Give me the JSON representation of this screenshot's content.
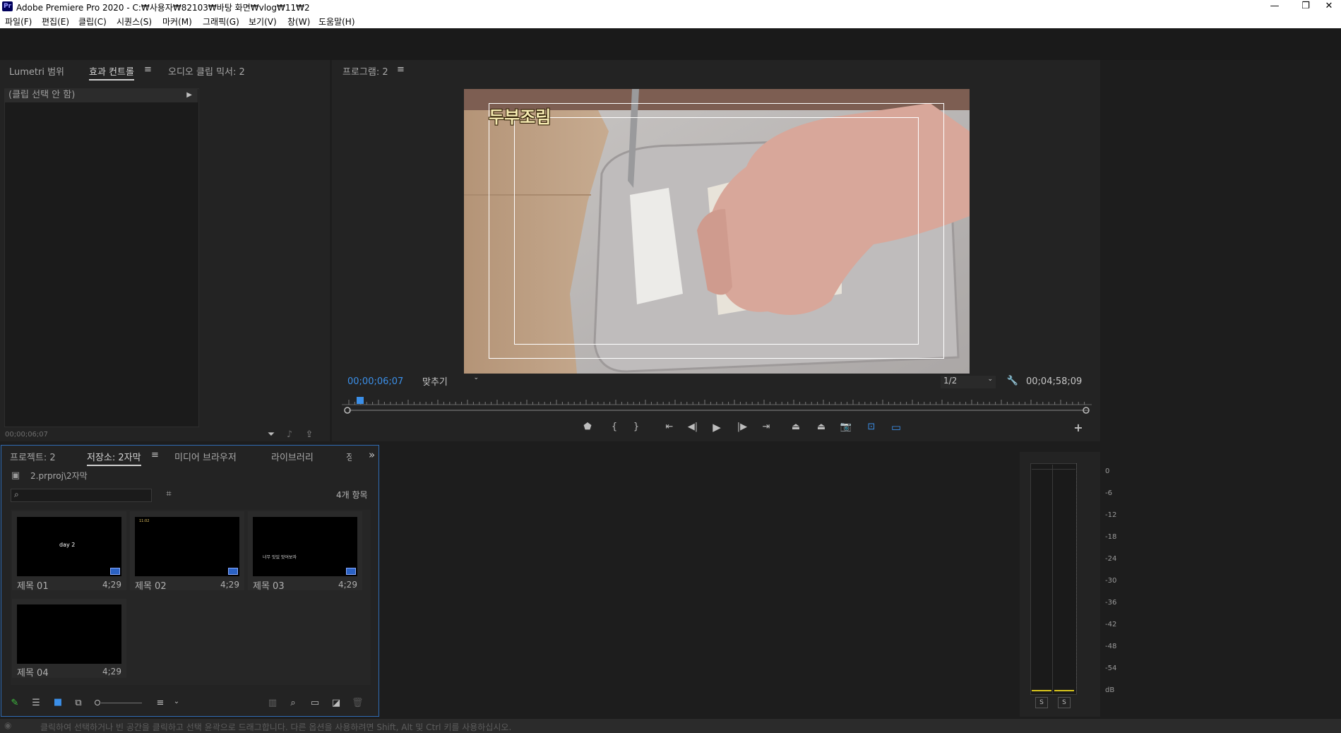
{
  "window": {
    "app_icon": "Pr",
    "title": "Adobe Premiere Pro 2020 - C:₩사용자₩82103₩바탕 화면₩vlog₩11₩2",
    "minimize": "—",
    "restore": "❐",
    "close": "✕"
  },
  "menu": [
    "파일(F)",
    "편집(E)",
    "클립(C)",
    "시퀀스(S)",
    "마커(M)",
    "그래픽(G)",
    "보기(V)",
    "창(W)",
    "도움말(H)"
  ],
  "effects_panel": {
    "tabs": [
      "Lumetri 범위",
      "효과 컨트롤",
      "오디오 클립 믹서: 2"
    ],
    "active_tab": "효과 컨트롤",
    "menu_icon": "≡",
    "clip_status": "(클립 선택 안 함)",
    "timecode": "00;00;06;07"
  },
  "program_monitor": {
    "tab": "프로그램: 2",
    "menu_icon": "≡",
    "title_overlay": "두부조림",
    "current_timecode": "00;00;06;07",
    "fit_select": "맞추기",
    "resolution_select": "1/2",
    "duration_timecode": "00;04;58;09",
    "add_button": "+"
  },
  "project_panel": {
    "tabs": [
      "프로젝트: 2",
      "저장소: 2자막",
      "미디어 브라우저",
      "라이브러리",
      "정"
    ],
    "active_tab": "저장소: 2자막",
    "menu_icon": "≡",
    "overflow_icon": "»",
    "path": "2.prproj\\2자막",
    "search_placeholder": "",
    "item_count": "4개 항목",
    "items": [
      {
        "name": "제목 01",
        "duration": "4;29",
        "thumb_text": "day 2"
      },
      {
        "name": "제목 02",
        "duration": "4;29",
        "thumb_text": "11:02"
      },
      {
        "name": "제목 03",
        "duration": "4;29",
        "thumb_text": "너무 맛있 맛어보자"
      },
      {
        "name": "제목 04",
        "duration": "4;29",
        "thumb_text": ""
      }
    ]
  },
  "audio_meter": {
    "scale": [
      "0",
      "-6",
      "-12",
      "-18",
      "-24",
      "-30",
      "-36",
      "-42",
      "-48",
      "-54",
      "dB"
    ],
    "solo_buttons": [
      "S",
      "S"
    ]
  },
  "status_bar": {
    "message": "클릭하여 선택하거나 빈 공간을 클릭하고 선택 윤곽으로 드래그합니다. 다른 옵션을 사용하려면 Shift, Alt 및 Ctrl 키를 사용하십시오."
  },
  "colors": {
    "accent_blue": "#2f6bb3",
    "timecode_blue": "#3b8fe8",
    "panel_bg": "#232323",
    "app_bg": "#1d1d1d",
    "meter_level": "#d8c51c"
  }
}
